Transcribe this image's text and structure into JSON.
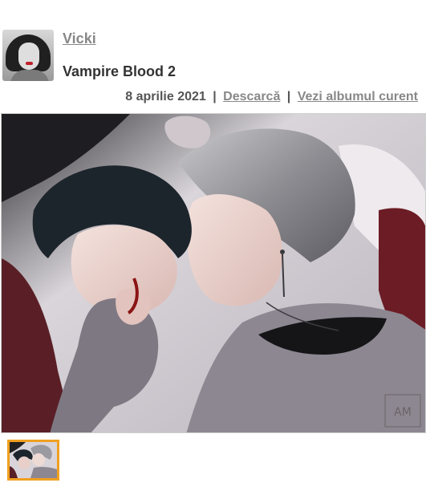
{
  "author": {
    "name": "Vicki",
    "avatar_icon": "user-avatar-icon"
  },
  "post": {
    "title": "Vampire Blood 2",
    "date": "8 aprilie 2021",
    "separator": "|",
    "download_label": "Descarcă",
    "album_label": "Vezi albumul curent"
  },
  "artwork": {
    "signature": "AM"
  },
  "colors": {
    "link": "#888888",
    "text": "#333333",
    "thumbnail_border": "#f0a020"
  }
}
